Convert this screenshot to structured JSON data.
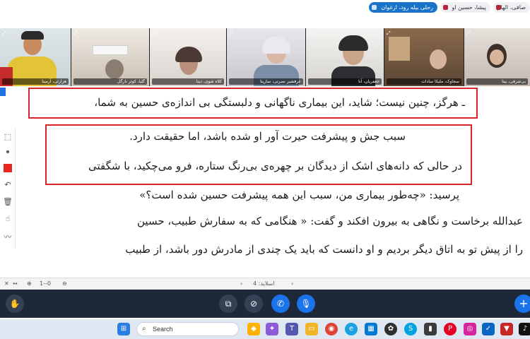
{
  "topbar": {
    "participants": [
      {
        "label": "رحلی بیله رود، ارغوان",
        "color": "#1a73c8"
      },
      {
        "label": "پیشا، حسین او",
        "color": "#eef0f4"
      },
      {
        "label": "صافی، الهام",
        "color": "#eef0f4"
      }
    ]
  },
  "video_tiles": [
    {
      "name": "هزارئی، آرمینا"
    },
    {
      "name": "گلیا، کوثر نارگل"
    },
    {
      "name": "کلاه شوی، دینا"
    },
    {
      "name": "عرفشیر نصرتی، سارینا"
    },
    {
      "name": "جعفریان، آنا"
    },
    {
      "name": "سجاوک، ملیکا سادات"
    },
    {
      "name": "بی‌شرقی، بیتا"
    }
  ],
  "slide": {
    "box1_line": "ـ هرگز، چنین نیست؛ شاید، این بیماری ناگهانی و دلبستگی بی اندازه‌ی حسین به شما،",
    "box2_line1": "سبب جش و پیشرفت حیرت آور او شده باشد، اما حقیقت دارد.",
    "box2_line2": "در حالی که دانه‌های اشک از دیدگان بر چهره‌ی بی‌رنگ ستاره، فرو می‌چکید، با شگفتی",
    "line3": "پرسید: «چه‌طور بیماری من، سبب این همه پیشرفت حسین شده است؟»",
    "line4": "عبدالله برخاست و نگاهی به بیرون افکند و گفت: « هنگامی که به سفارش طبیب، حسین",
    "line5": "را از پیش تو به اتاق دیگر بردیم و او دانست که باید یک چندی از مادرش دور باشد، از طبیب"
  },
  "palette": {
    "pen_color": "#e8261f"
  },
  "navbar": {
    "slide_label": "اسلاید: 4",
    "zoom_min": "1--0"
  },
  "controls": {
    "buttons": [
      "hand-icon",
      "share-screen-icon",
      "camera-off-icon",
      "phone-icon",
      "microphone-icon",
      "plus-icon"
    ]
  },
  "taskbar": {
    "search_placeholder": "Search"
  },
  "colors": {
    "accent": "#1a73c8",
    "highlight_box": "#d9252b",
    "controls_bg": "#1d2939",
    "taskbar_bg": "#dfe7f2"
  }
}
